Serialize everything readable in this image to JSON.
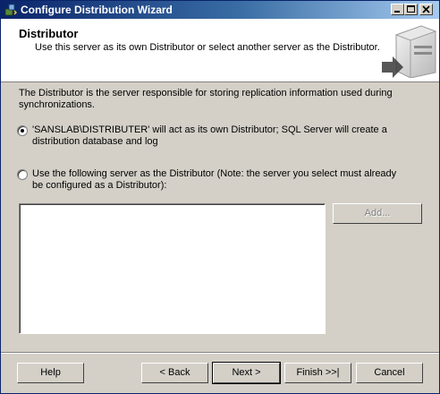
{
  "window": {
    "title": "Configure Distribution Wizard",
    "controls": [
      "minimize-icon",
      "maximize-icon",
      "close-icon"
    ]
  },
  "header": {
    "title": "Distributor",
    "subtitle": "Use this server as its own Distributor or select another server as the Distributor."
  },
  "intro": "The Distributor is the server responsible for storing replication information used during synchronizations.",
  "options": [
    {
      "label": "'SANSLAB\\DISTRIBUTER' will act as its own Distributor; SQL Server will create a distribution database and log",
      "selected": true
    },
    {
      "label": "Use the following server as the Distributor (Note: the server you select must already be configured as a Distributor):",
      "selected": false
    }
  ],
  "add_button": "Add...",
  "footer": {
    "help": "Help",
    "back": "< Back",
    "next": "Next >",
    "finish": "Finish >>|",
    "cancel": "Cancel"
  },
  "colors": {
    "title_bar_start": "#0a246a",
    "title_bar_end": "#a6caf0",
    "face": "#d4d0c8"
  }
}
